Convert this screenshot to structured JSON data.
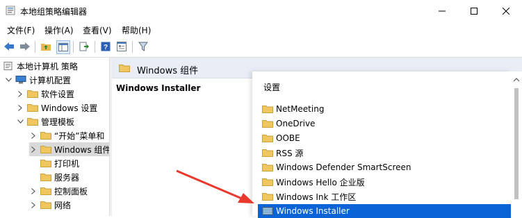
{
  "window": {
    "title": "本地组策略编辑器"
  },
  "menu": [
    "文件(F)",
    "操作(A)",
    "查看(V)",
    "帮助(H)"
  ],
  "tree": {
    "items": [
      {
        "label": "本地计算机 策略"
      },
      {
        "label": "计算机配置"
      },
      {
        "label": "软件设置"
      },
      {
        "label": "Windows 设置"
      },
      {
        "label": "管理模板"
      },
      {
        "label": "“开始”菜单和"
      },
      {
        "label": "Windows 组件"
      },
      {
        "label": "打印机"
      },
      {
        "label": "服务器"
      },
      {
        "label": "控制面板"
      },
      {
        "label": "网络"
      }
    ]
  },
  "right": {
    "header": "Windows 组件",
    "desc_title": "Windows Installer",
    "list_header": "设置",
    "items": [
      "NetMeeting",
      "OneDrive",
      "OOBE",
      "RSS 源",
      "Windows Defender SmartScreen",
      "Windows Hello 企业版",
      "Windows Ink 工作区",
      "Windows Installer"
    ]
  },
  "colors": {
    "selection": "#0a64d7",
    "folder": "#e8b84a",
    "arrow": "#e8392c",
    "header_bg": "#e8edf6"
  }
}
